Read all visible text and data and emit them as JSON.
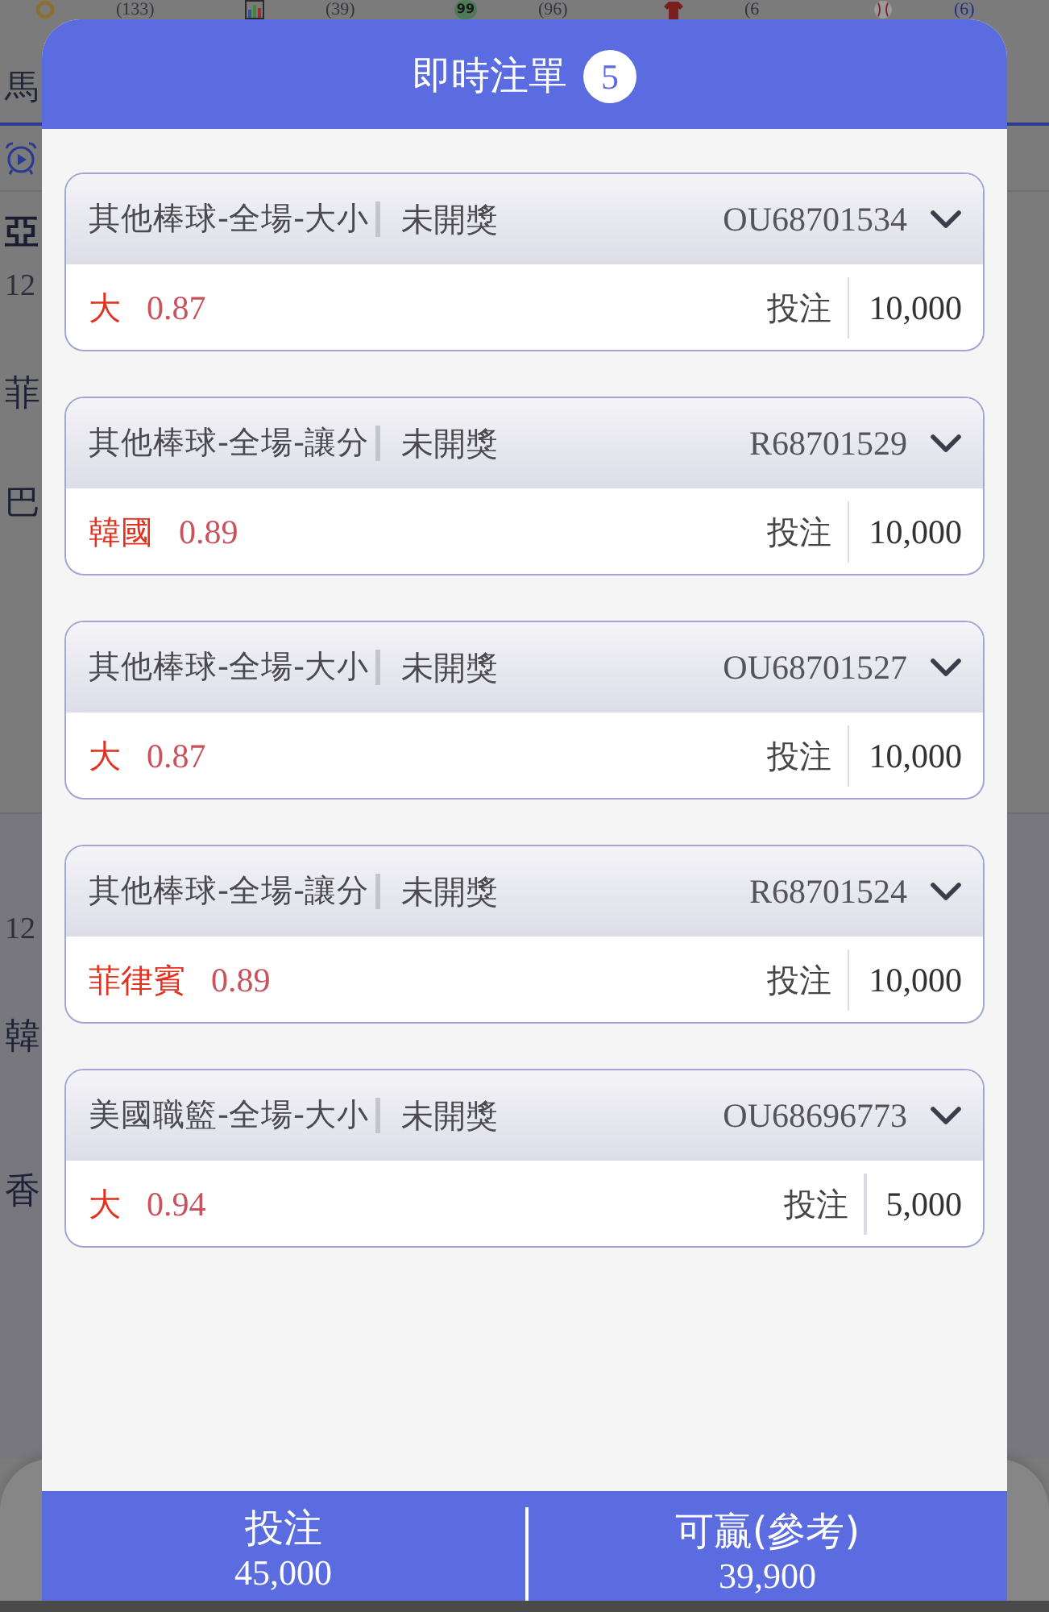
{
  "background": {
    "top_tabs": [
      {
        "kind": "ring",
        "count": "(133)",
        "selected": false
      },
      {
        "kind": "chart",
        "count": "(39)",
        "selected": false
      },
      {
        "kind": "ball",
        "badge": "99",
        "count": "(96)",
        "selected": false
      },
      {
        "kind": "shirt",
        "count": "(6",
        "selected": false
      },
      {
        "kind": "baseball",
        "count": "(6)",
        "selected": true
      }
    ],
    "tab_label": "馬",
    "matches": [
      {
        "league": "亞",
        "time": "12",
        "teams": [
          "菲",
          "巴"
        ]
      },
      {
        "time": "12",
        "teams": [
          "韓",
          "香"
        ]
      }
    ]
  },
  "dialog": {
    "title": "即時注單",
    "count": "5",
    "bets": [
      {
        "market": "其他棒球-全場-大小",
        "status": "未開獎",
        "ticket": "OU68701534",
        "expanded": false,
        "pick": "大",
        "odds": "0.87",
        "stake_label": "投注",
        "stake": "10,000"
      },
      {
        "market": "其他棒球-全場-讓分",
        "status": "未開獎",
        "ticket": "R68701529",
        "expanded": false,
        "pick": "韓國",
        "odds": "0.89",
        "stake_label": "投注",
        "stake": "10,000"
      },
      {
        "market": "其他棒球-全場-大小",
        "status": "未開獎",
        "ticket": "OU68701527",
        "expanded": false,
        "pick": "大",
        "odds": "0.87",
        "stake_label": "投注",
        "stake": "10,000"
      },
      {
        "market": "其他棒球-全場-讓分",
        "status": "未開獎",
        "ticket": "R68701524",
        "expanded": false,
        "pick": "菲律賓",
        "odds": "0.89",
        "stake_label": "投注",
        "stake": "10,000"
      },
      {
        "market": "美國職籃-全場-大小",
        "status": "未開獎",
        "ticket": "OU68696773",
        "expanded": false,
        "pick": "大",
        "odds": "0.94",
        "stake_label": "投注",
        "stake": "5,000"
      }
    ],
    "summary": [
      {
        "label": "投注",
        "value": "45,000"
      },
      {
        "label": "可贏(參考)",
        "value": "39,900"
      }
    ]
  }
}
